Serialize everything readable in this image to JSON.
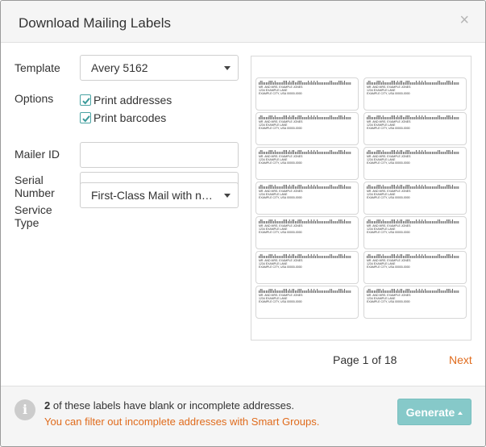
{
  "dialog": {
    "title": "Download Mailing Labels",
    "close_glyph": "×"
  },
  "form": {
    "template_label": "Template",
    "template_value": "Avery 5162",
    "options_label": "Options",
    "option_print_addresses": "Print addresses",
    "option_print_addresses_checked": true,
    "option_print_barcodes": "Print barcodes",
    "option_print_barcodes_checked": true,
    "mailer_id_label": "Mailer ID",
    "mailer_id_value": "",
    "serial_number_label_1": "Serial",
    "serial_number_label_2": "Number",
    "serial_number_value": "",
    "service_type_label_1": "Service",
    "service_type_label_2": "Type",
    "service_type_value": "First-Class Mail with no ..."
  },
  "preview": {
    "labels": [
      {
        "line1": "MR. AND MRS. EXAMPLE JONES",
        "line2": "1234 EXAMPLE LANE",
        "line3": "EXAMPLE CITY, USA 00000-0000"
      },
      {
        "line1": "MR. AND MRS. EXAMPLE JONES",
        "line2": "1234 EXAMPLE LANE",
        "line3": "EXAMPLE CITY, USA 00000-0000"
      },
      {
        "line1": "MR. AND MRS. EXAMPLE JONES",
        "line2": "1234 EXAMPLE LANE",
        "line3": "EXAMPLE CITY, USA 00000-0000"
      },
      {
        "line1": "MR. AND MRS. EXAMPLE JONES",
        "line2": "1234 EXAMPLE LANE",
        "line3": "EXAMPLE CITY, USA 00000-0000"
      },
      {
        "line1": "MR. AND MRS. EXAMPLE JONES",
        "line2": "1234 EXAMPLE LANE",
        "line3": "EXAMPLE CITY, USA 00000-0000"
      },
      {
        "line1": "MR. AND MRS. EXAMPLE JONES",
        "line2": "1234 EXAMPLE LANE",
        "line3": "EXAMPLE CITY, USA 00000-0000"
      },
      {
        "line1": "MR. AND MRS. EXAMPLE JONES",
        "line2": "1234 EXAMPLE LANE",
        "line3": "EXAMPLE CITY, USA 00000-0000"
      },
      {
        "line1": "MR. AND MRS. EXAMPLE JONES",
        "line2": "1234 EXAMPLE LANE",
        "line3": "EXAMPLE CITY, USA 00000-0000"
      },
      {
        "line1": "MR. AND MRS. EXAMPLE JONES",
        "line2": "1234 EXAMPLE LANE",
        "line3": "EXAMPLE CITY, USA 00000-0000"
      },
      {
        "line1": "MR. AND MRS. EXAMPLE JONES",
        "line2": "1234 EXAMPLE LANE",
        "line3": "EXAMPLE CITY, USA 00000-0000"
      },
      {
        "line1": "MR. AND MRS. EXAMPLE JONES",
        "line2": "1234 EXAMPLE LANE",
        "line3": "EXAMPLE CITY, USA 00000-0000"
      },
      {
        "line1": "MR. AND MRS. EXAMPLE JONES",
        "line2": "1234 EXAMPLE LANE",
        "line3": "EXAMPLE CITY, USA 00000-0000"
      },
      {
        "line1": "MR. AND MRS. EXAMPLE JONES",
        "line2": "1234 EXAMPLE LANE",
        "line3": "EXAMPLE CITY, USA 00000-0000"
      },
      {
        "line1": "MR. AND MRS. EXAMPLE JONES",
        "line2": "1234 EXAMPLE LANE",
        "line3": "EXAMPLE CITY, USA 00000-0000"
      }
    ],
    "page_indicator": "Page 1 of 18",
    "next_label": "Next"
  },
  "footer": {
    "info_icon": "info-icon",
    "count": "2",
    "message": " of these labels have blank or incomplete addresses.",
    "filter_link": "You can filter out incomplete addresses with Smart Groups.",
    "generate_label": "Generate"
  },
  "colors": {
    "accent_teal": "#86c9c9",
    "checkbox_teal": "#4aa3a3",
    "link_orange": "#e06b1c"
  }
}
